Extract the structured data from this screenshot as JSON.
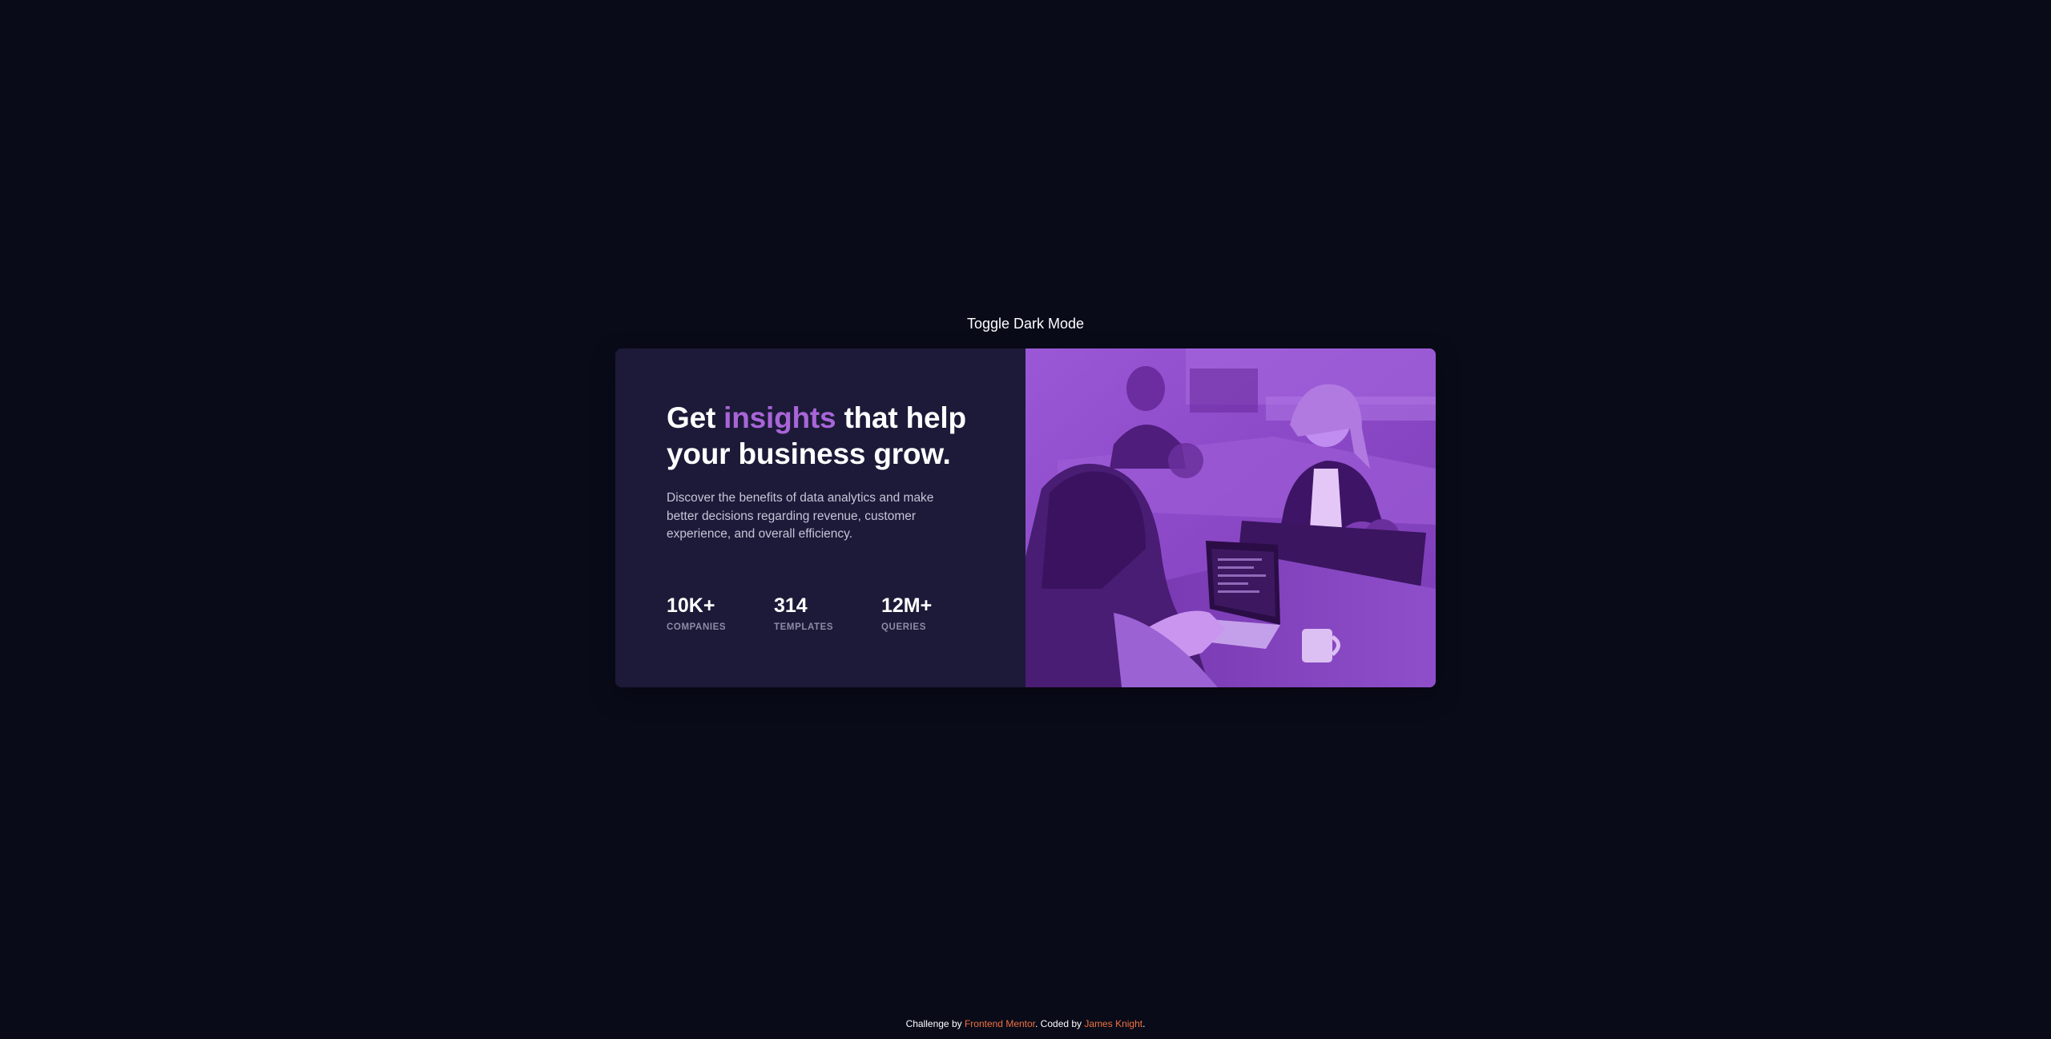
{
  "toggle": {
    "label": "Toggle Dark Mode"
  },
  "card": {
    "headline": {
      "before": "Get ",
      "accent": "insights",
      "after": " that help your business grow."
    },
    "description": "Discover the benefits of data analytics and make better decisions regarding revenue, customer experience, and overall efficiency.",
    "stats": [
      {
        "value": "10K+",
        "label": "Companies"
      },
      {
        "value": "314",
        "label": "Templates"
      },
      {
        "value": "12M+",
        "label": "Queries"
      }
    ],
    "image": {
      "icon": "office-team-photo"
    }
  },
  "footer": {
    "prefix": "Challenge by ",
    "link1": "Frontend Mentor",
    "middle": ". Coded by ",
    "link2": "James Knight",
    "suffix": "."
  },
  "colors": {
    "background": "#090b19",
    "card": "#1c1a38",
    "accent": "#a965d8",
    "photo_tint": "#8d4cc9",
    "link": "#f0723f"
  }
}
